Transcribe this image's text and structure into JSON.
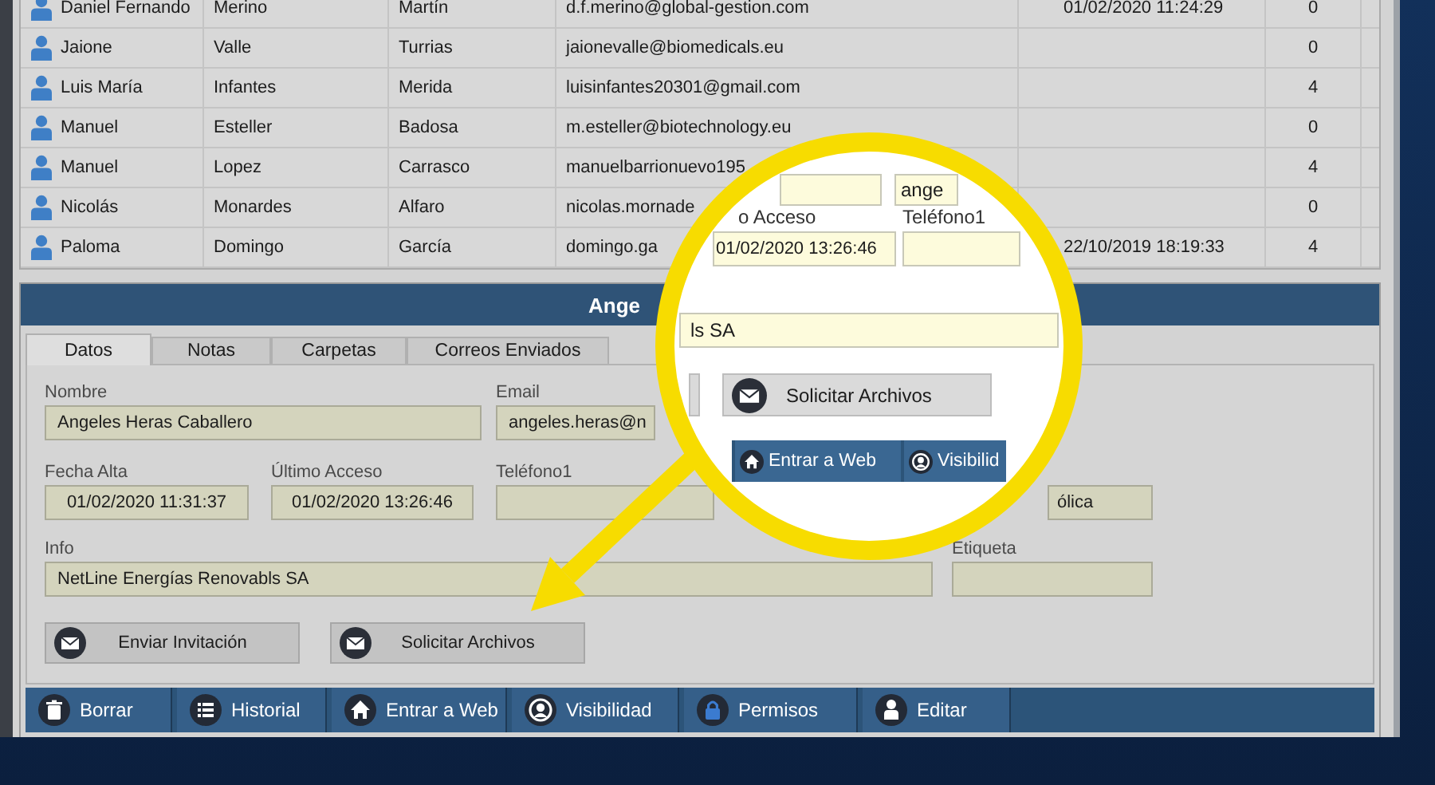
{
  "table": {
    "rows": [
      {
        "column_1": "Daniel Fernando",
        "column_2": "Merino",
        "column_3": "Martín",
        "column_4": "d.f.merino@global-gestion.com",
        "column_5": "01/02/2020 11:24:29",
        "column_6": "0"
      },
      {
        "column_1": "Jaione",
        "column_2": "Valle",
        "column_3": "Turrias",
        "column_4": "jaionevalle@biomedicals.eu",
        "column_6": "0"
      },
      {
        "column_1": "Luis María",
        "column_2": "Infantes",
        "column_3": "Merida",
        "column_4": "luisinfantes20301@gmail.com",
        "column_6": "4"
      },
      {
        "column_1": "Manuel",
        "column_2": "Esteller",
        "column_3": "Badosa",
        "column_4": "m.esteller@biotechnology.eu",
        "column_6": "0"
      },
      {
        "column_1": "Manuel",
        "column_2": "Lopez",
        "column_3": "Carrasco",
        "column_4": "manuelbarrionuevo195",
        "column_6": "4"
      },
      {
        "column_1": "Nicolás",
        "column_2": "Monardes",
        "column_3": "Alfaro",
        "column_4": "nicolas.mornade",
        "column_6": "0"
      },
      {
        "column_1": "Paloma",
        "column_2": "Domingo",
        "column_3": "García",
        "column_4": "domingo.ga",
        "column_5": "22/10/2019 18:19:33",
        "column_6": "4"
      }
    ]
  },
  "detail": {
    "title": "Ange",
    "tabs": [
      {
        "label": "Datos",
        "selected": true
      },
      {
        "label": "Notas",
        "selected": false
      },
      {
        "label": "Carpetas",
        "selected": false
      },
      {
        "label": "Correos Enviados",
        "selected": false
      }
    ],
    "field_rows": [
      [
        {
          "label": "Nombre",
          "value": "Angeles Heras Caballero"
        },
        {
          "label": "Email",
          "value": "angeles.heras@n"
        },
        {}
      ],
      [
        {
          "label": "Fecha Alta",
          "value": "01/02/2020 11:31:37"
        },
        {
          "label": "Último Acceso",
          "value": "01/02/2020 13:26:46"
        },
        {
          "label": "Teléfono1"
        },
        {
          "value": "ólica"
        }
      ],
      [
        {
          "label": "Info",
          "value": "NetLine Energías Renovabls SA"
        },
        {
          "label": "Etiqueta"
        }
      ]
    ],
    "actions": [
      "Enviar Invitación",
      "Solicitar Archivos"
    ],
    "toolbar": [
      "Borrar",
      "Historial",
      "Entrar a Web",
      "Visibilidad",
      "Permisos",
      "Editar"
    ]
  },
  "magnifier": {
    "email_value": "ange",
    "last_access_label": "o Acceso",
    "last_access_value": "01/02/2020 13:26:46",
    "phone_label": "Teléfono1",
    "info_value": "ls SA",
    "action": "Solicitar Archivos",
    "toolbar": [
      "Entrar a Web",
      "Visibilid"
    ]
  }
}
